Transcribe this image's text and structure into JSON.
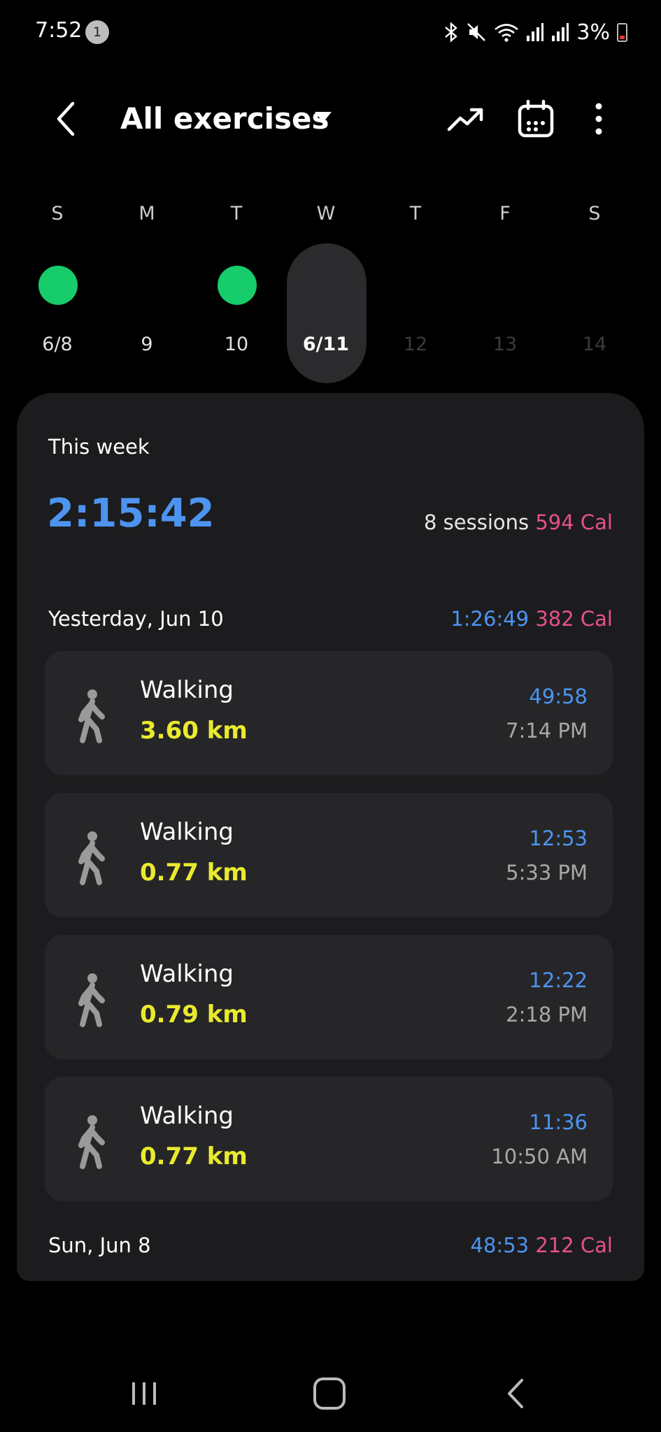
{
  "status_bar": {
    "time": "7:52",
    "notification_count": "1",
    "battery": "3%"
  },
  "header": {
    "title": "All exercises"
  },
  "week": {
    "days": [
      {
        "name": "S",
        "date": "6/8",
        "has_activity": true,
        "selected": false,
        "future": false
      },
      {
        "name": "M",
        "date": "9",
        "has_activity": false,
        "selected": false,
        "future": false
      },
      {
        "name": "T",
        "date": "10",
        "has_activity": true,
        "selected": false,
        "future": false
      },
      {
        "name": "W",
        "date": "6/11",
        "has_activity": false,
        "selected": true,
        "future": false
      },
      {
        "name": "T",
        "date": "12",
        "has_activity": false,
        "selected": false,
        "future": true
      },
      {
        "name": "F",
        "date": "13",
        "has_activity": false,
        "selected": false,
        "future": true
      },
      {
        "name": "S",
        "date": "14",
        "has_activity": false,
        "selected": false,
        "future": true
      }
    ],
    "activity_color": "#17cc6b"
  },
  "summary": {
    "label": "This week",
    "total_time": "2:15:42",
    "sessions": "8 sessions",
    "calories": "594 Cal"
  },
  "groups": [
    {
      "date": "Yesterday, Jun 10",
      "duration": "1:26:49",
      "calories": "382 Cal",
      "exercises": [
        {
          "icon": "walking-icon",
          "name": "Walking",
          "distance": "3.60 km",
          "duration": "49:58",
          "time": "7:14 PM"
        },
        {
          "icon": "walking-icon",
          "name": "Walking",
          "distance": "0.77 km",
          "duration": "12:53",
          "time": "5:33 PM"
        },
        {
          "icon": "walking-icon",
          "name": "Walking",
          "distance": "0.79 km",
          "duration": "12:22",
          "time": "2:18 PM"
        },
        {
          "icon": "walking-icon",
          "name": "Walking",
          "distance": "0.77 km",
          "duration": "11:36",
          "time": "10:50 AM"
        }
      ]
    },
    {
      "date": "Sun, Jun 8",
      "duration": "48:53",
      "calories": "212 Cal",
      "exercises": []
    }
  ],
  "colors": {
    "duration_blue": "#4d94f0",
    "calorie_pink": "#e7518a",
    "distance_yellow": "#eaea2e"
  }
}
